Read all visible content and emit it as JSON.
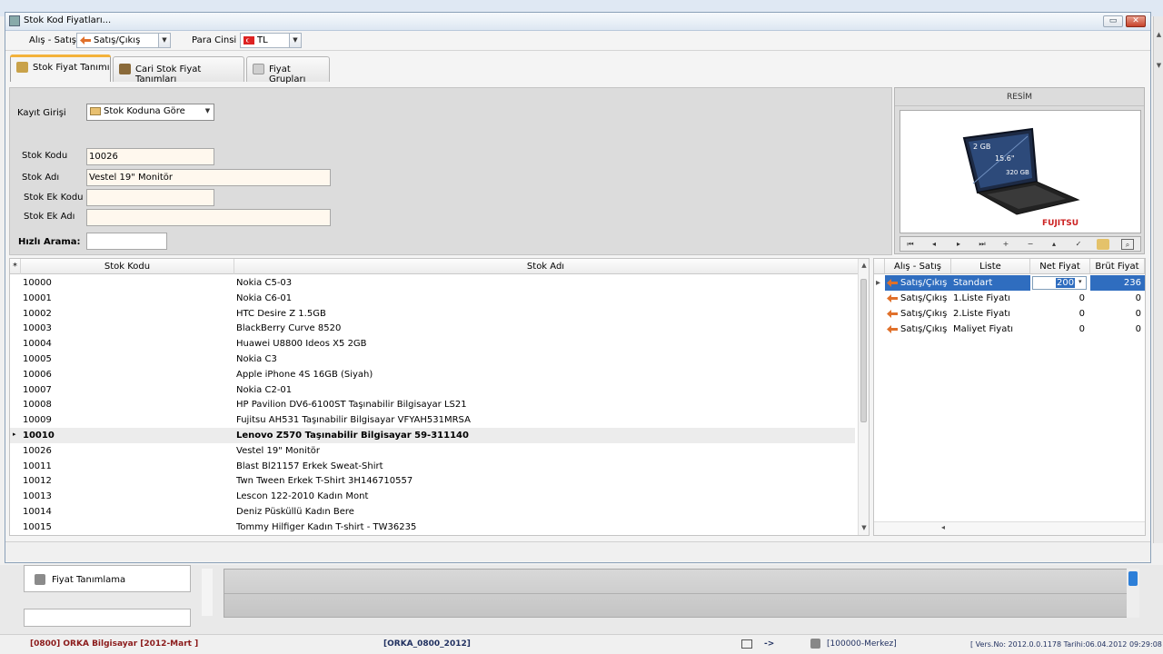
{
  "window": {
    "title": "Stok Kod Fiyatları..."
  },
  "toolbar": {
    "alis_satis_label": "Alış - Satış",
    "alis_satis_value": "Satış/Çıkış",
    "para_cinsi_label": "Para Cinsi",
    "para_cinsi_value": "TL"
  },
  "tabs": [
    {
      "label": "Stok Fiyat Tanımı",
      "active": true
    },
    {
      "label": "Cari Stok Fiyat Tanımları",
      "active": false
    },
    {
      "label": "Fiyat Grupları",
      "active": false
    }
  ],
  "form": {
    "kayit_girisi_label": "Kayıt Girişi",
    "kayit_girisi_value": "Stok Koduna Göre",
    "stok_kodu_label": "Stok Kodu",
    "stok_kodu_value": "10026",
    "stok_adi_label": "Stok Adı",
    "stok_adi_value": "Vestel 19\" Monitör",
    "stok_ek_kodu_label": "Stok Ek Kodu",
    "stok_ek_kodu_value": "",
    "stok_ek_adi_label": "Stok Ek Adı",
    "stok_ek_adi_value": "",
    "hizli_arama_label": "Hızlı Arama:",
    "hizli_arama_value": ""
  },
  "picture": {
    "header": "RESİM",
    "brand": "FUJITSU",
    "ram_text": "2 GB",
    "screen_text": "15.6\"",
    "disk_text": "320 GB"
  },
  "grid": {
    "col_code": "Stok Kodu",
    "col_name": "Stok Adı",
    "selected_index": 10,
    "rows": [
      {
        "code": "10000",
        "name": "Nokia C5-03"
      },
      {
        "code": "10001",
        "name": "Nokia C6-01"
      },
      {
        "code": "10002",
        "name": "HTC Desire Z 1.5GB"
      },
      {
        "code": "10003",
        "name": "BlackBerry Curve 8520"
      },
      {
        "code": "10004",
        "name": "Huawei U8800 Ideos X5 2GB"
      },
      {
        "code": "10005",
        "name": "Nokia C3"
      },
      {
        "code": "10006",
        "name": "Apple iPhone 4S 16GB (Siyah)"
      },
      {
        "code": "10007",
        "name": "Nokia C2-01"
      },
      {
        "code": "10008",
        "name": "HP Pavilion DV6-6100ST Taşınabilir Bilgisayar LS21"
      },
      {
        "code": "10009",
        "name": "Fujitsu AH531 Taşınabilir Bilgisayar VFYAH531MRSA"
      },
      {
        "code": "10010",
        "name": "Lenovo Z570 Taşınabilir Bilgisayar 59-311140"
      },
      {
        "code": "10026",
        "name": "Vestel 19\" Monitör"
      },
      {
        "code": "10011",
        "name": "Blast Bl21157 Erkek Sweat-Shirt"
      },
      {
        "code": "10012",
        "name": "Twn Tween Erkek T-Shirt 3H146710557"
      },
      {
        "code": "10013",
        "name": "Lescon 122-2010 Kadın Mont"
      },
      {
        "code": "10014",
        "name": "Deniz Püsküllü Kadın Bere"
      },
      {
        "code": "10015",
        "name": "Tommy Hilfiger Kadın T-shirt - TW36235"
      }
    ]
  },
  "prices": {
    "col_type": "Alış - Satış",
    "col_list": "Liste",
    "col_net": "Net Fiyat",
    "col_gross": "Brüt Fiyat",
    "rows": [
      {
        "type": "Satış/Çıkış",
        "list": "Standart",
        "net": "200",
        "gross": "236"
      },
      {
        "type": "Satış/Çıkış",
        "list": "1.Liste Fiyatı",
        "net": "0",
        "gross": "0"
      },
      {
        "type": "Satış/Çıkış",
        "list": "2.Liste Fiyatı",
        "net": "0",
        "gross": "0"
      },
      {
        "type": "Satış/Çıkış",
        "list": "Maliyet Fiyatı",
        "net": "0",
        "gross": "0"
      }
    ]
  },
  "sidebar": {
    "item_label": "Fiyat Tanımlama"
  },
  "statusbar": {
    "company": "[0800] ORKA Bilgisayar [2012-Mart   ]",
    "database": "[ORKA_0800_2012]",
    "arrow": "->",
    "branch": "[100000-Merkez]",
    "version": "[ Vers.No: 2012.0.0.1178  Tarihi:06.04.2012 09:29:08"
  },
  "colors": {
    "selection": "#2f6dbf",
    "tab_accent": "#f3b23a",
    "arrow_orange": "#e0702a",
    "status_red": "#8b1a1a"
  }
}
